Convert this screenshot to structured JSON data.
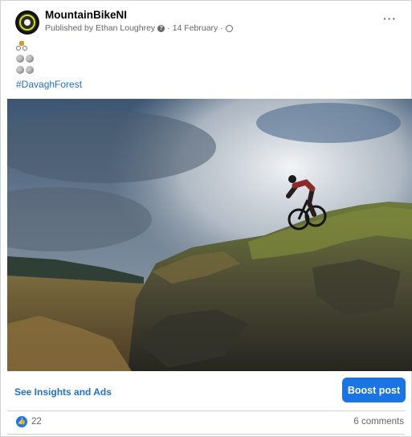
{
  "post": {
    "page_name": "MountainBikeNI",
    "published_by": "Published by Ethan Loughrey",
    "date": "14 February",
    "separator": "·",
    "more_label": "···",
    "hashtag": "#DavaghForest"
  },
  "footer": {
    "insights_label": "See Insights and Ads",
    "boost_label": "Boost post",
    "likes": "22",
    "comments": "6 comments"
  },
  "icons": {
    "avatar": "mountainbikeni-logo",
    "published_info": "question-icon",
    "audience": "globe-icon",
    "reaction": "thumbs-up-icon"
  },
  "colors": {
    "link": "#216fdb",
    "boost_button": "#1b74e4",
    "like": "#1877f2"
  }
}
